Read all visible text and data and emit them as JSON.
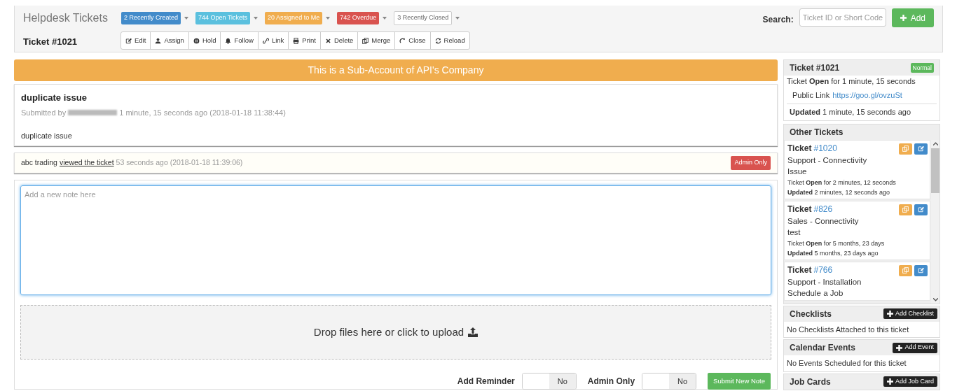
{
  "header": {
    "title": "Helpdesk Tickets",
    "ticket": "Ticket #1021",
    "search_label": "Search:",
    "search_placeholder": "Ticket ID or Short Code",
    "add_button": "Add"
  },
  "filters": [
    {
      "label": "2 Recently Created",
      "color": "#428bca"
    },
    {
      "label": "744 Open Tickets",
      "color": "#5bc0de"
    },
    {
      "label": "20 Assigned to Me",
      "color": "#f0ad4e"
    },
    {
      "label": "742 Overdue",
      "color": "#d9534f"
    },
    {
      "label": "3 Recently Closed",
      "color": "#ffffff"
    }
  ],
  "toolbar": [
    {
      "label": "Edit"
    },
    {
      "label": "Assign"
    },
    {
      "label": "Hold"
    },
    {
      "label": "Follow"
    },
    {
      "label": "Link"
    },
    {
      "label": "Print"
    },
    {
      "label": "Delete"
    },
    {
      "label": "Merge"
    },
    {
      "label": "Close"
    },
    {
      "label": "Reload"
    }
  ],
  "banner": "This is a Sub-Account of API's Company",
  "ticket": {
    "subject": "duplicate issue",
    "submitted_prefix": "Submitted by",
    "submitted_suffix": "1 minute, 15 seconds ago (2018-01-18 11:38:44)",
    "body": "duplicate issue"
  },
  "activity": {
    "actor": "abc trading",
    "action": "viewed the ticket",
    "time": "53 seconds ago (2018-01-18 11:39:06)",
    "badge": "Admin Only"
  },
  "note": {
    "placeholder": "Add a new note here",
    "upload": "Drop files here or click to upload"
  },
  "footer": {
    "toggles": [
      {
        "label": "Add Reminder",
        "on": false,
        "off_text": "No"
      },
      {
        "label": "Admin Only",
        "on": false,
        "off_text": "No"
      }
    ],
    "submit": "Submit New Note"
  },
  "sidebar": {
    "summary": {
      "title": "Ticket #1021",
      "priority": "Normal",
      "open_line": "Ticket **Open** for 1 minute, 15 seconds",
      "public_label": "Public Link",
      "public_link": "https://goo.gl/ovzuSt",
      "updated": "**Updated** 1 minute, 15 seconds ago"
    },
    "other_title": "Other Tickets",
    "other": [
      {
        "prefix": "Ticket",
        "number": "#1020",
        "lines": [
          "Support - Connectivity",
          "Issue"
        ],
        "open": "Ticket **Open** for 2 minutes, 12 seconds",
        "updated": "**Updated** 2 minutes, 12 seconds ago"
      },
      {
        "prefix": "Ticket",
        "number": "#826",
        "lines": [
          "Sales - Connectivity",
          "test"
        ],
        "open": "Ticket **Open** for 5 months, 23 days",
        "updated": "**Updated** 5 months, 23 days ago"
      },
      {
        "prefix": "Ticket",
        "number": "#766",
        "lines": [
          "Support - Installation",
          "Schedule a Job"
        ]
      }
    ],
    "sections": [
      {
        "title": "Checklists",
        "button": "Add Checklist",
        "empty": "No Checklists Attached to this ticket"
      },
      {
        "title": "Calendar Events",
        "button": "Add Event",
        "empty": "No Events Scheduled for this ticket"
      },
      {
        "title": "Job Cards",
        "button": "Add Job Card"
      }
    ]
  }
}
